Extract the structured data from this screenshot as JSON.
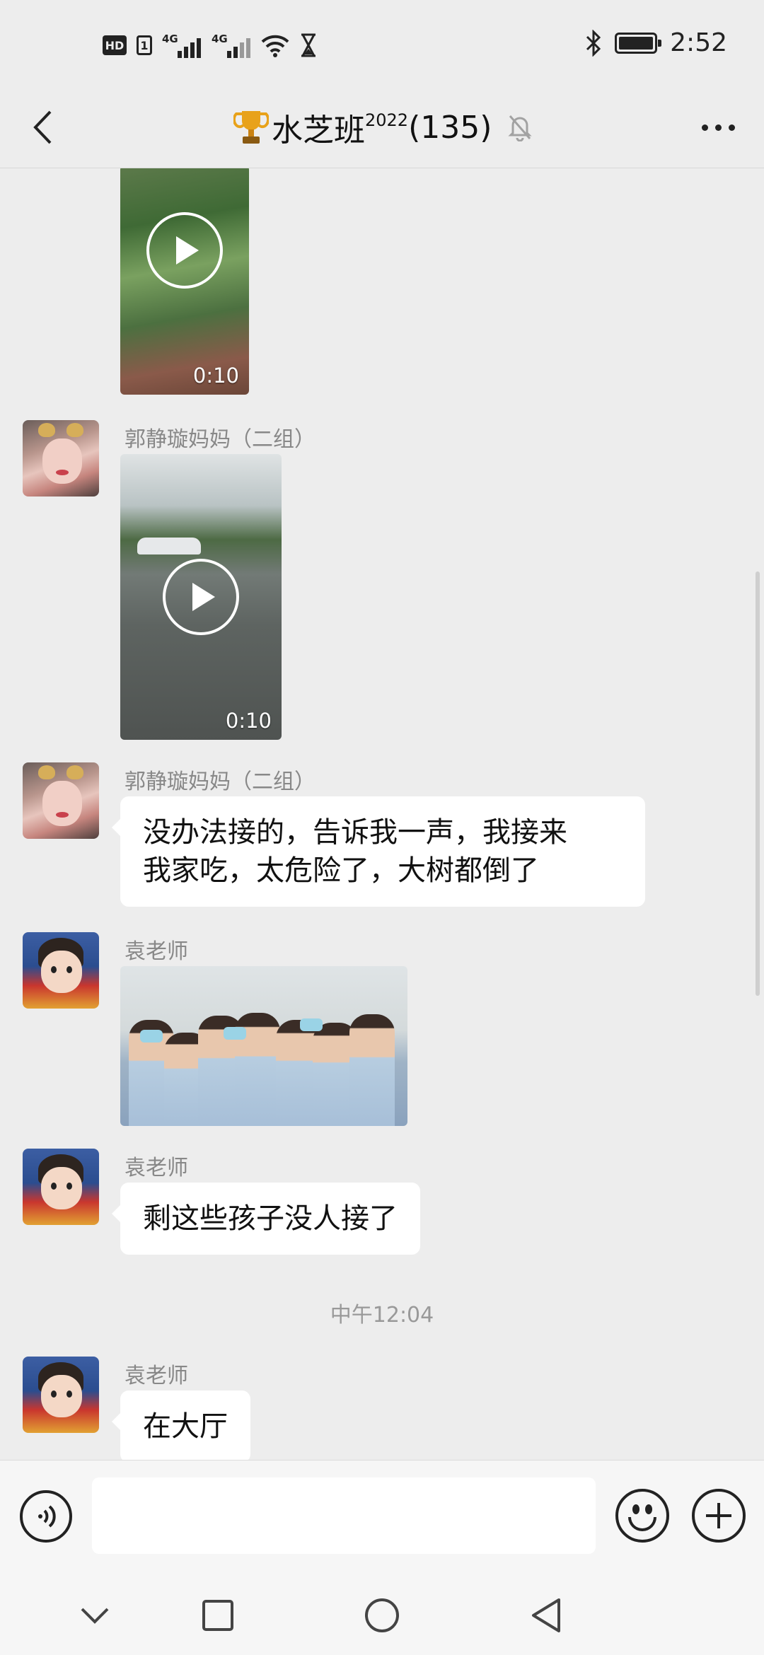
{
  "status_bar": {
    "hd_label": "HD",
    "sim_label": "1",
    "network_1": "4G",
    "network_2": "4G",
    "time": "2:52"
  },
  "header": {
    "trophy_icon": "trophy-icon",
    "title_main": "水芝班",
    "title_sup": "2022",
    "title_count": "(135)"
  },
  "messages": [
    {
      "type": "video",
      "sender": "",
      "duration": "0:10"
    },
    {
      "type": "video",
      "sender": "郭静璇妈妈（二组）",
      "duration": "0:10"
    },
    {
      "type": "text",
      "sender": "郭静璇妈妈（二组）",
      "lines": [
        "没办法接的，告诉我一声，我接来",
        "我家吃，太危险了，大树都倒了"
      ]
    },
    {
      "type": "image",
      "sender": "袁老师"
    },
    {
      "type": "text",
      "sender": "袁老师",
      "lines": [
        "剩这些孩子没人接了"
      ]
    },
    {
      "type": "time",
      "text": "中午12:04"
    },
    {
      "type": "text",
      "sender": "袁老师",
      "lines": [
        "在大厅"
      ]
    }
  ],
  "input": {
    "value": "",
    "placeholder": ""
  },
  "colors": {
    "background": "#ededed",
    "bubble": "#ffffff",
    "sender": "#888888",
    "bar": "#f6f6f6"
  }
}
